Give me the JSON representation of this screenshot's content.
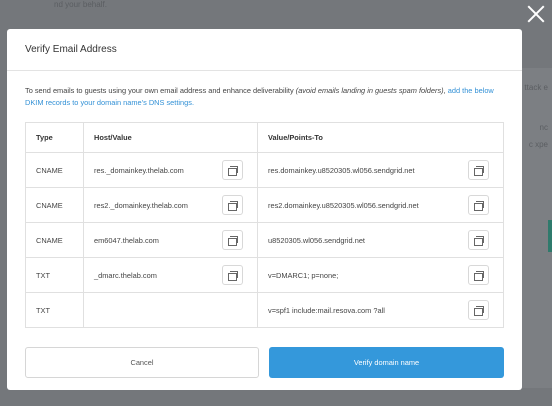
{
  "background": {
    "top_text": "nd your behalf.",
    "right_texts": [
      "ttack e",
      "nc",
      "c xpe"
    ]
  },
  "modal": {
    "title": "Verify Email Address",
    "description": {
      "text": "To send emails to guests using your own email address and enhance deliverability ",
      "italic": "(avoid emails landing in guests spam folders)",
      "after_italic": ",",
      "link": "add the below DKIM records to your domain name's DNS settings."
    },
    "table": {
      "headers": [
        "Type",
        "Host/Value",
        "Value/Points-To"
      ],
      "rows": [
        {
          "type": "CNAME",
          "host": "res._domainkey.thelab.com",
          "value": "res.domainkey.u8520305.wl056.sendgrid.net"
        },
        {
          "type": "CNAME",
          "host": "res2._domainkey.thelab.com",
          "value": "res2.domainkey.u8520305.wl056.sendgrid.net"
        },
        {
          "type": "CNAME",
          "host": "em6047.thelab.com",
          "value": "u8520305.wl056.sendgrid.net"
        },
        {
          "type": "TXT",
          "host": "_dmarc.thelab.com",
          "value": "v=DMARC1; p=none;"
        },
        {
          "type": "TXT",
          "host": "",
          "value": "v=spf1 include:mail.resova.com ?all"
        }
      ]
    },
    "buttons": {
      "cancel": "Cancel",
      "verify": "Verify domain name"
    }
  },
  "colors": {
    "accent": "#3498db",
    "link": "#3391d6",
    "overlay": "#6f7276"
  },
  "icons": {
    "close": "close-icon",
    "copy": "copy-icon"
  }
}
